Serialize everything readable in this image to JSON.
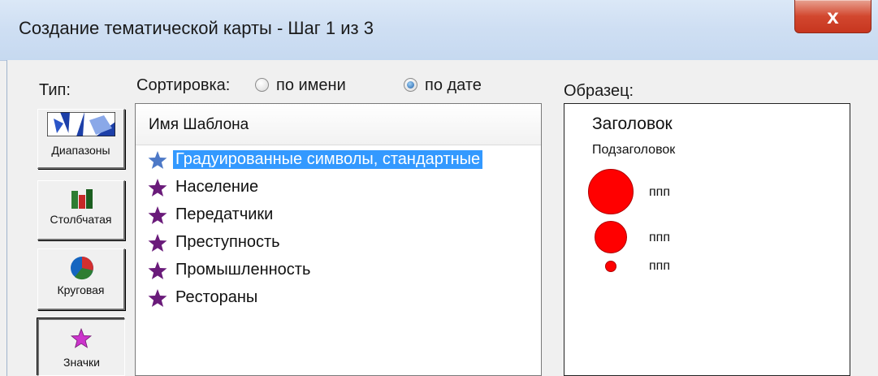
{
  "window": {
    "title": "Создание тематической карты - Шаг 1 из 3",
    "close_glyph": "x"
  },
  "type_section": {
    "label": "Тип:",
    "buttons": [
      {
        "label": "Диапазоны",
        "icon": "ranges-icon"
      },
      {
        "label": "Столбчатая",
        "icon": "bar-chart-icon"
      },
      {
        "label": "Круговая",
        "icon": "pie-chart-icon"
      },
      {
        "label": "Значки",
        "icon": "star-symbol-icon",
        "selected": true
      }
    ]
  },
  "sort": {
    "label": "Сортировка:",
    "options": [
      {
        "label": "по имени",
        "checked": false
      },
      {
        "label": "по дате",
        "checked": true
      }
    ]
  },
  "templates": {
    "header": "Имя Шаблона",
    "items": [
      {
        "label": "Градуированные символы, стандартные",
        "selected": true
      },
      {
        "label": "Население"
      },
      {
        "label": "Передатчики"
      },
      {
        "label": "Преступность"
      },
      {
        "label": "Промышленность"
      },
      {
        "label": "Рестораны"
      }
    ],
    "star_color": "#6a1b7a",
    "selected_star_color": "#4d79c7"
  },
  "sample": {
    "label": "Образец:",
    "title": "Заголовок",
    "subtitle": "Подзаголовок",
    "legend": [
      {
        "label": "ппп"
      },
      {
        "label": "ппп"
      },
      {
        "label": "ппп"
      }
    ],
    "symbol_color": "#ff0000"
  }
}
